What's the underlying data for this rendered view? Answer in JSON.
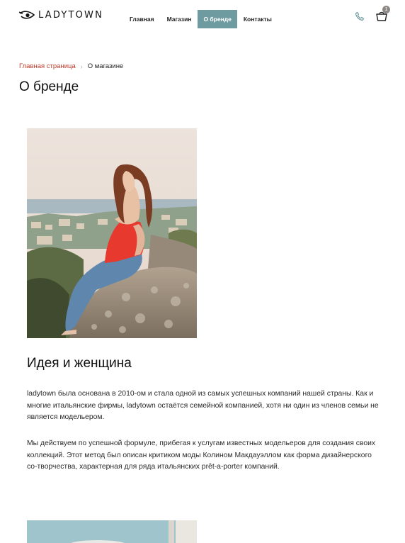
{
  "header": {
    "logo_text": "LADYTOWN",
    "logo_icon": "eye-logo-icon",
    "nav": [
      {
        "label": "Главная",
        "active": false
      },
      {
        "label": "Магазин",
        "active": false
      },
      {
        "label": "О бренде",
        "active": true
      },
      {
        "label": "Контакты",
        "active": false
      }
    ],
    "phone_icon": "phone-icon",
    "cart_icon": "basket-icon",
    "cart_count": "1"
  },
  "breadcrumb": {
    "home": "Главная страница",
    "current": "О магазине"
  },
  "page": {
    "title": "О бренде",
    "section_title": "Идея и женщина",
    "paragraphs": [
      "ladytown была основана в 2010-ом и стала одной из самых успешных компаний нашей страны. Как и многие итальянские фирмы, ladytown остаётся семейной компанией, хотя ни один из членов семьи не является модельером.",
      "Мы действуем по успешной формуле, прибегая к услугам известных модельеров для создания своих коллекций. Этот метод был описан критиком моды Колином Макдауэллом как форма дизайнерского со-творчества, характерная для ряда итальянских prêt-a-porter компаний."
    ]
  },
  "colors": {
    "accent": "#6e9ba0",
    "breadcrumb_link": "#c23a2a",
    "badge": "#8e8986"
  }
}
